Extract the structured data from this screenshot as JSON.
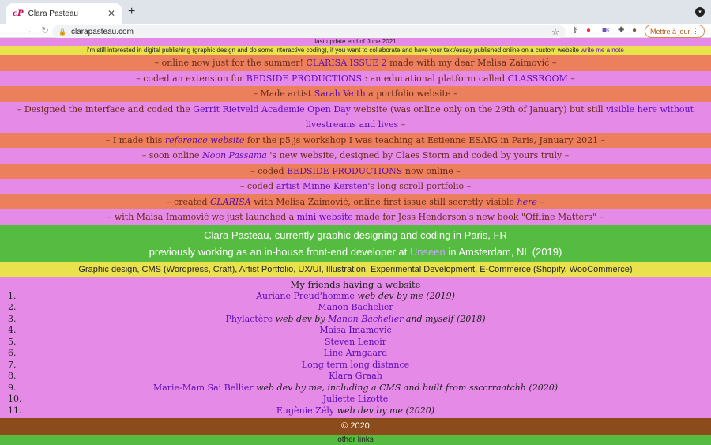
{
  "browser": {
    "tab_title": "Clara Pasteau",
    "favicon": "cP",
    "url": "clarapasteau.com",
    "update_button": "Mettre à jour",
    "ext_badge": "5"
  },
  "site": {
    "last_update": "last update end of June 2021",
    "collab": "i'm still interested in digital publishing (graphic design and do some interactive coding), if you want to collaborate and have your text/essay published online on a custom website",
    "collab_link": "write me a note",
    "news": [
      {
        "a": "– online now just for the summer! ",
        "l": "CLARISA ISSUE 2",
        "b": " made with my dear Melisa Zaimović –"
      },
      {
        "a": "– coded an extension for ",
        "l": "BEDSIDE PRODUCTIONS",
        "b": " : an educational platform called ",
        "l2": "CLASSROOM",
        "c": " –"
      },
      {
        "a": "– Made artist ",
        "l": "Sarah Veith",
        "b": " a portfolio website –"
      },
      {
        "a": "– Designed the interface and coded the ",
        "l": "Gerrit Rietveld Academie Open Day",
        "b": " website (was online only on the 29th of January) but still ",
        "l2": "visible here without livestreams and lives",
        "c": " –"
      },
      {
        "a": "– I made this ",
        "l": "reference website",
        "b": " for the p5.js workshop I was teaching at Estienne ESAIG in Paris, January 2021 –"
      },
      {
        "a": "– soon online ",
        "l": "Noon Passama",
        "b": " 's new website, designed by Claes Storm and coded by yours truly –"
      },
      {
        "a": "– coded ",
        "l": "BEDSIDE PRODUCTIONS",
        "b": " now online –"
      },
      {
        "a": "– coded ",
        "l": "artist Minne Kersten",
        "b": "'s long scroll portfolio –"
      },
      {
        "a": "– created ",
        "l": "CLARISA",
        "b": " with Melisa Zaimović, online first issue still secretly visible ",
        "l2": "here",
        "c": " –"
      },
      {
        "a": "– with Maisa Imamović we just launched a ",
        "l": "mini website",
        "b": " made for Jess Henderson's new book \"Offline Matters\" –"
      }
    ],
    "intro_line1": "Clara Pasteau, currently graphic designing and coding in Paris, FR",
    "intro_line2a": "previously working as an in-house front-end developer at ",
    "intro_link": "Unseen",
    "intro_line2b": " in Amsterdam, NL (2019)",
    "skills": "Graphic design, CMS (Wordpress, Craft), Artist Portfolio, UX/UI, Illustration, Experimental Development, E-Commerce (Shopify, WooCommerce)",
    "friends_title": "My friends having a website",
    "friends": [
      {
        "n": "1.",
        "name": "Auriane Preud'homme",
        "note": " web dev by me (2019)"
      },
      {
        "n": "2.",
        "name": "Manon Bachelier",
        "note": ""
      },
      {
        "n": "3.",
        "name": "Phylactère",
        "note": " web dev by ",
        "name2": "Manon Bachelier",
        "note2": " and myself (2018)"
      },
      {
        "n": "4.",
        "name": "Maisa Imamović",
        "note": ""
      },
      {
        "n": "5.",
        "name": "Steven Lenoir",
        "note": ""
      },
      {
        "n": "6.",
        "name": "Line Arngaard",
        "note": ""
      },
      {
        "n": "7.",
        "name": "Long term long distance",
        "note": ""
      },
      {
        "n": "8.",
        "name": "Klara Graah",
        "note": ""
      },
      {
        "n": "9.",
        "name": "Marie-Mam Sai Bellier",
        "note": " web dev by me, including a CMS and built from ssccrraatchh (2020)"
      },
      {
        "n": "10.",
        "name": "Juliette Lizotte",
        "note": ""
      },
      {
        "n": "11.",
        "name": "Eugènie Zély",
        "note": " web dev by me (2020)"
      }
    ],
    "copyright": "© 2020",
    "other_links": "other links"
  }
}
